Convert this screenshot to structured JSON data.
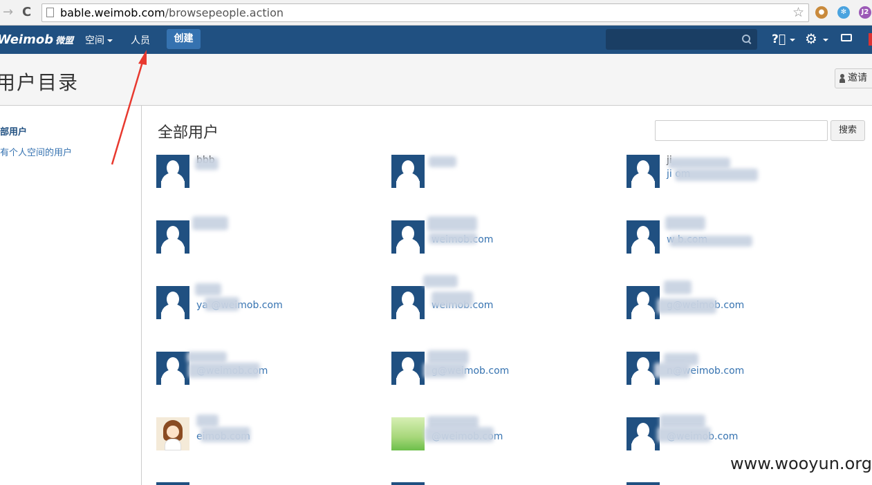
{
  "browser": {
    "url_host": "bable.weimob.com",
    "url_path": "/browsepeople.action",
    "extensions": [
      "cookie-icon",
      "puzzle-icon",
      "J2"
    ]
  },
  "appbar": {
    "logo": "Weimob",
    "logo_cn": "微盟",
    "menu_space": "空间",
    "menu_people": "人员",
    "create": "创建"
  },
  "page": {
    "title": "用户目录",
    "invite": "邀请"
  },
  "sidebar": {
    "all_users": "部用户",
    "users_with_space": "有个人空间的用户"
  },
  "main": {
    "heading": "全部用户",
    "search_button": "搜索",
    "users": [
      {
        "name": "bbb",
        "email": "",
        "avatar": "default"
      },
      {
        "name": "",
        "email": "",
        "avatar": "default"
      },
      {
        "name": "ji",
        "email": "ji om",
        "avatar": "default"
      },
      {
        "name": "",
        "email": "",
        "avatar": "default"
      },
      {
        "name": "",
        "email": "weimob.com",
        "avatar": "default"
      },
      {
        "name": "",
        "email": "w b.com",
        "avatar": "default"
      },
      {
        "name": "",
        "email": "ya @weimob.com",
        "avatar": "default"
      },
      {
        "name": "",
        "email": "weimob.com",
        "avatar": "default"
      },
      {
        "name": "",
        "email": "g@weimob.com",
        "avatar": "default"
      },
      {
        "name": "",
        "email": "@weimob.com",
        "avatar": "default"
      },
      {
        "name": "",
        "email": "g@weimob.com",
        "avatar": "default"
      },
      {
        "name": "",
        "email": "n@weimob.com",
        "avatar": "default"
      },
      {
        "name": "",
        "email": "eimob.com",
        "avatar": "cartoon"
      },
      {
        "name": "",
        "email": "@weimob.com",
        "avatar": "grass"
      },
      {
        "name": "",
        "email": "@weimob.com",
        "avatar": "default"
      }
    ]
  },
  "watermark": "www.wooyun.org",
  "colors": {
    "header": "#205081",
    "button": "#3572b0",
    "link": "#3572b0",
    "annotation_arrow": "#e8392f"
  }
}
